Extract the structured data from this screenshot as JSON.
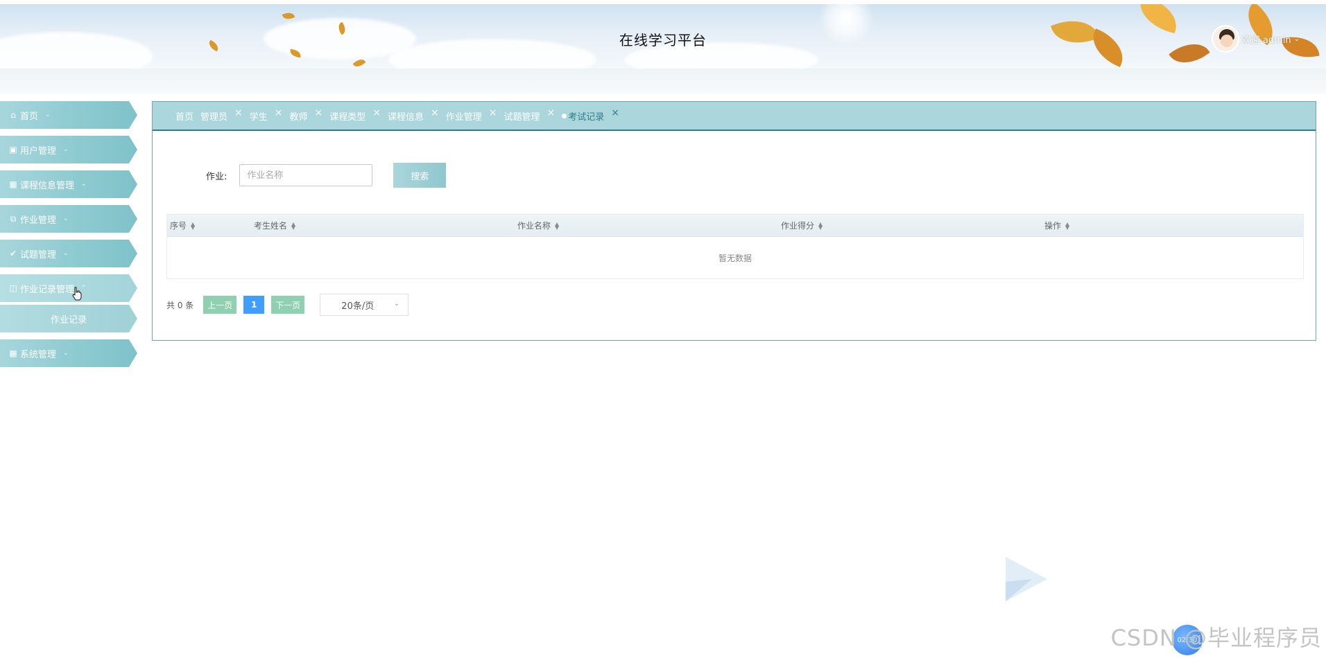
{
  "header": {
    "title": "在线学习平台",
    "welcome": "欢迎 admin"
  },
  "sidebar": {
    "items": [
      {
        "label": "首页",
        "icon": "home-icon"
      },
      {
        "label": "用户管理",
        "icon": "user-card-icon"
      },
      {
        "label": "课程信息管理",
        "icon": "grid-icon"
      },
      {
        "label": "作业管理",
        "icon": "layers-icon"
      },
      {
        "label": "试题管理",
        "icon": "check-circle-icon"
      },
      {
        "label": "作业记录管理",
        "icon": "book-icon"
      },
      {
        "label": "系统管理",
        "icon": "settings-doc-icon"
      }
    ],
    "submenu": {
      "label": "作业记录"
    }
  },
  "tabs": [
    {
      "label": "首页",
      "closable": false
    },
    {
      "label": "管理员",
      "closable": true
    },
    {
      "label": "学生",
      "closable": true
    },
    {
      "label": "教师",
      "closable": true
    },
    {
      "label": "课程类型",
      "closable": true
    },
    {
      "label": "课程信息",
      "closable": true
    },
    {
      "label": "作业管理",
      "closable": true
    },
    {
      "label": "试题管理",
      "closable": true
    },
    {
      "label": "考试记录",
      "closable": true,
      "active": true
    }
  ],
  "search": {
    "label": "作业:",
    "placeholder": "作业名称",
    "button": "搜索"
  },
  "table": {
    "columns": [
      "序号",
      "考生姓名",
      "作业名称",
      "作业得分",
      "操作"
    ],
    "empty_text": "暂无数据"
  },
  "pager": {
    "total": "共 0 条",
    "prev": "上一页",
    "page": "1",
    "next": "下一页",
    "page_size": "20条/页"
  },
  "watermark": "CSDN @毕业程序员",
  "float_ball_text": "02:30",
  "colors": {
    "accent": "#8ecbd1",
    "tab_bar": "#aad6dc",
    "active_tab": "#2d7d8a",
    "page_btn": "#409eff",
    "pager_btn": "#8fd0b0"
  }
}
